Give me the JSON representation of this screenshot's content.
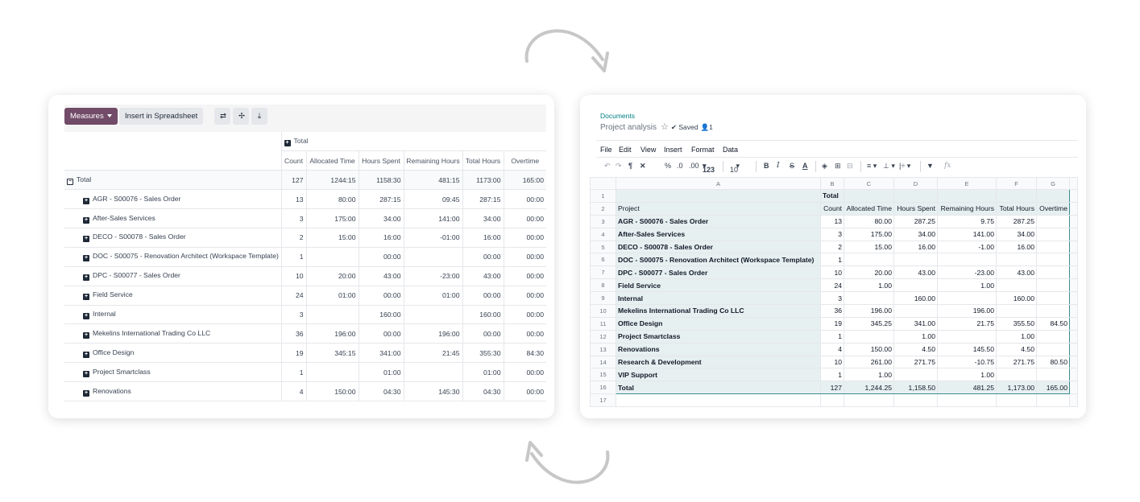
{
  "pivot": {
    "toolbar": {
      "measures_label": "Measures",
      "insert_label": "Insert in Spreadsheet"
    },
    "col_group_label": "Total",
    "measures": [
      "Count",
      "Allocated Time",
      "Hours Spent",
      "Remaining Hours",
      "Total Hours",
      "Overtime"
    ],
    "total_row": {
      "label": "Total",
      "values": [
        "127",
        "1244:15",
        "1158:30",
        "481:15",
        "1173:00",
        "165:00"
      ]
    },
    "rows": [
      {
        "label": "AGR - S00076 - Sales Order",
        "values": [
          "13",
          "80:00",
          "287:15",
          "09:45",
          "287:15",
          "00:00"
        ]
      },
      {
        "label": "After-Sales Services",
        "values": [
          "3",
          "175:00",
          "34:00",
          "141:00",
          "34:00",
          "00:00"
        ]
      },
      {
        "label": "DECO - S00078 - Sales Order",
        "values": [
          "2",
          "15:00",
          "16:00",
          "-01:00",
          "16:00",
          "00:00"
        ]
      },
      {
        "label": "DOC - S00075 - Renovation Architect (Workspace Template)",
        "values": [
          "1",
          "",
          "00:00",
          "",
          "00:00",
          "00:00"
        ]
      },
      {
        "label": "DPC - S00077 - Sales Order",
        "values": [
          "10",
          "20:00",
          "43:00",
          "-23:00",
          "43:00",
          "00:00"
        ]
      },
      {
        "label": "Field Service",
        "values": [
          "24",
          "01:00",
          "00:00",
          "01:00",
          "00:00",
          "00:00"
        ]
      },
      {
        "label": "Internal",
        "values": [
          "3",
          "",
          "160:00",
          "",
          "160:00",
          "00:00"
        ]
      },
      {
        "label": "Mekelins International Trading Co LLC",
        "values": [
          "36",
          "196:00",
          "00:00",
          "196:00",
          "00:00",
          "00:00"
        ]
      },
      {
        "label": "Office Design",
        "values": [
          "19",
          "345:15",
          "341:00",
          "21:45",
          "355:30",
          "84:30"
        ]
      },
      {
        "label": "Project Smartclass",
        "values": [
          "1",
          "",
          "01:00",
          "",
          "01:00",
          "00:00"
        ]
      },
      {
        "label": "Renovations",
        "values": [
          "4",
          "150:00",
          "04:30",
          "145:30",
          "04:30",
          "00:00"
        ]
      }
    ]
  },
  "sheet": {
    "breadcrumb": "Documents",
    "title": "Project analysis",
    "saved_label": "Saved",
    "user_count": "1",
    "menu": [
      "File",
      "Edit",
      "View",
      "Insert",
      "Format",
      "Data"
    ],
    "toolbar": {
      "percent": "%",
      "dec_less": ".0",
      "dec_more": ".00",
      "number_format": "123",
      "font_size": "10",
      "bold": "B",
      "italic": "I",
      "strike": "S",
      "underline": "A",
      "fx": "fx"
    },
    "columns": [
      "A",
      "B",
      "C",
      "D",
      "E",
      "F",
      "G"
    ],
    "header_total": "Total",
    "header_row": [
      "Project",
      "Count",
      "Allocated Time",
      "Hours Spent",
      "Remaining Hours",
      "Total Hours",
      "Overtime"
    ],
    "rows": [
      [
        "AGR - S00076 - Sales Order",
        "13",
        "80.00",
        "287.25",
        "9.75",
        "287.25",
        ""
      ],
      [
        "After-Sales Services",
        "3",
        "175.00",
        "34.00",
        "141.00",
        "34.00",
        ""
      ],
      [
        "DECO - S00078 - Sales Order",
        "2",
        "15.00",
        "16.00",
        "-1.00",
        "16.00",
        ""
      ],
      [
        "DOC - S00075 - Renovation Architect (Workspace Template)",
        "1",
        "",
        "",
        "",
        "",
        ""
      ],
      [
        "DPC - S00077 - Sales Order",
        "10",
        "20.00",
        "43.00",
        "-23.00",
        "43.00",
        ""
      ],
      [
        "Field Service",
        "24",
        "1.00",
        "",
        "1.00",
        "",
        ""
      ],
      [
        "Internal",
        "3",
        "",
        "160.00",
        "",
        "160.00",
        ""
      ],
      [
        "Mekelins International Trading Co LLC",
        "36",
        "196.00",
        "",
        "196.00",
        "",
        ""
      ],
      [
        "Office Design",
        "19",
        "345.25",
        "341.00",
        "21.75",
        "355.50",
        "84.50"
      ],
      [
        "Project Smartclass",
        "1",
        "",
        "1.00",
        "",
        "1.00",
        ""
      ],
      [
        "Renovations",
        "4",
        "150.00",
        "4.50",
        "145.50",
        "4.50",
        ""
      ],
      [
        "Research & Development",
        "10",
        "261.00",
        "271.75",
        "-10.75",
        "271.75",
        "80.50"
      ],
      [
        "VIP Support",
        "1",
        "1.00",
        "",
        "1.00",
        "",
        ""
      ]
    ],
    "total_row": [
      "Total",
      "127",
      "1,244.25",
      "1,158.50",
      "481.25",
      "1,173.00",
      "165.00"
    ],
    "row_numbers": [
      "1",
      "2",
      "3",
      "4",
      "5",
      "6",
      "7",
      "8",
      "9",
      "10",
      "11",
      "12",
      "13",
      "14",
      "15",
      "16",
      "17"
    ]
  },
  "colors": {
    "accent": "#714b67",
    "teal": "#017e84",
    "selection": "#e7f0f1"
  }
}
